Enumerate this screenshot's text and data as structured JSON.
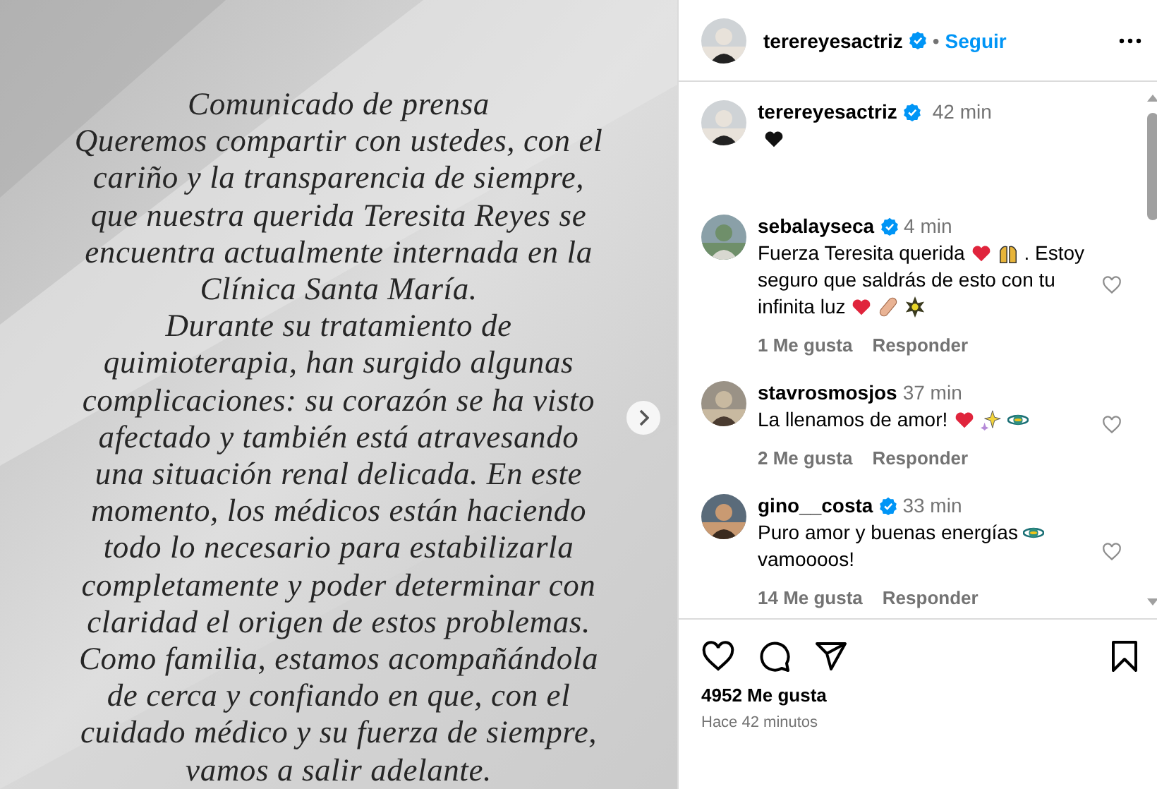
{
  "post_image": {
    "lines": [
      "Comunicado de prensa",
      "Queremos compartir con ustedes, con el",
      "cariño y la transparencia de siempre,",
      "que nuestra querida Teresita Reyes se",
      "encuentra actualmente internada en la",
      "Clínica Santa María.",
      "Durante su tratamiento de",
      "quimioterapia, han surgido algunas",
      "complicaciones: su corazón se ha visto",
      "afectado y también está atravesando",
      "una situación renal delicada. En este",
      "momento, los médicos están haciendo",
      "todo lo necesario para estabilizarla",
      "completamente y poder determinar con",
      "claridad el origen de estos problemas.",
      "Como familia, estamos acompañándola",
      "de cerca y confiando en que, con el",
      "cuidado médico y su fuerza de siempre,",
      "vamos a salir adelante."
    ]
  },
  "header": {
    "username": "terereyesactriz",
    "verified": true,
    "separator": "•",
    "follow": "Seguir"
  },
  "caption": {
    "username": "terereyesactriz",
    "verified": true,
    "time": "42 min",
    "parts": [
      {
        "kind": "black-heart"
      }
    ]
  },
  "comments": [
    {
      "username": "sebalayseca",
      "verified": true,
      "time": "4 min",
      "parts": [
        {
          "kind": "text",
          "text": "Fuerza Teresita querida"
        },
        {
          "kind": "heart"
        },
        {
          "kind": "hands"
        },
        {
          "kind": "text",
          "text": ". Estoy seguro que saldrás de esto con tu infinita luz"
        },
        {
          "kind": "heart"
        },
        {
          "kind": "bandage"
        },
        {
          "kind": "sun"
        }
      ],
      "likes": "1 Me gusta",
      "reply": "Responder"
    },
    {
      "username": "stavrosmosjos",
      "verified": false,
      "time": "37 min",
      "parts": [
        {
          "kind": "text",
          "text": "La llenamos de amor!"
        },
        {
          "kind": "heart"
        },
        {
          "kind": "sparkles"
        },
        {
          "kind": "planet"
        }
      ],
      "likes": "2 Me gusta",
      "reply": "Responder"
    },
    {
      "username": "gino__costa",
      "verified": true,
      "time": "33 min",
      "parts": [
        {
          "kind": "text",
          "text": "Puro amor y buenas energías"
        },
        {
          "kind": "planet"
        },
        {
          "kind": "text",
          "text": "vamoooos!"
        }
      ],
      "likes": "14 Me gusta",
      "reply": "Responder"
    }
  ],
  "likes": "4952 Me gusta",
  "posted": "Hace 42 minutos"
}
